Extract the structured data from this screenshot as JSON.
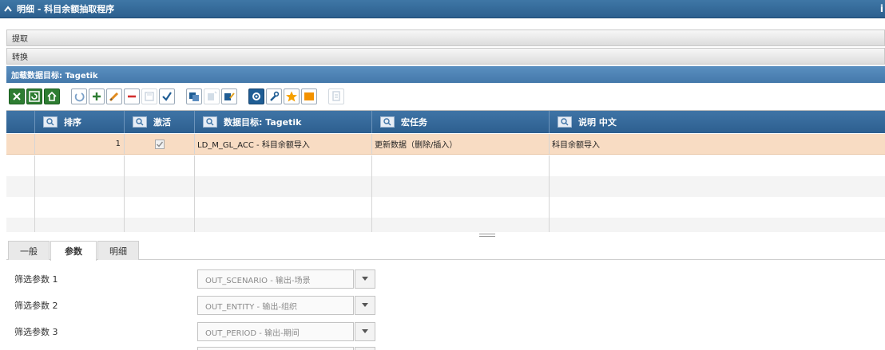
{
  "window": {
    "title": "明细 - 科目余额抽取程序",
    "info_icon": "i"
  },
  "sections": {
    "extract": "提取",
    "transform": "转换"
  },
  "load_target_header": "加载数据目标: Tagetik",
  "grid": {
    "columns": [
      "排序",
      "激活",
      "数据目标: Tagetik",
      "宏任务",
      "说明 中文"
    ],
    "rows": [
      {
        "order": "1",
        "active": true,
        "target": "LD_M_GL_ACC - 科目余额导入",
        "macro": "更新数据（删除/插入）",
        "description": "科目余额导入"
      }
    ]
  },
  "tabs": [
    "一般",
    "参数",
    "明细"
  ],
  "active_tab": "参数",
  "params": [
    {
      "label": "筛选参数 1",
      "value": "OUT_SCENARIO - 输出-场景"
    },
    {
      "label": "筛选参数 2",
      "value": "OUT_ENTITY - 输出-组织"
    },
    {
      "label": "筛选参数 3",
      "value": "OUT_PERIOD - 输出-期间"
    }
  ]
}
